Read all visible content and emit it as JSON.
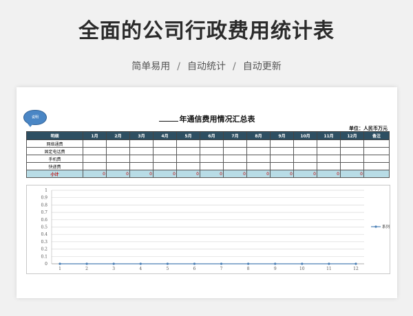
{
  "hero": {
    "title": "全面的公司行政费用统计表",
    "tags": [
      "简单易用",
      "自动统计",
      "自动更新"
    ],
    "separator": "/"
  },
  "sheet": {
    "bubble_text": "说明",
    "title": "年通信费用情况汇总表",
    "unit": "单位：人民币万元",
    "columns": [
      "明细",
      "1月",
      "2月",
      "3月",
      "4月",
      "5月",
      "6月",
      "7月",
      "8月",
      "9月",
      "10月",
      "11月",
      "12月",
      "备注"
    ],
    "rows": [
      "网络通费",
      "固定电话费",
      "手机费",
      "快递费"
    ],
    "subtotal_label": "小计",
    "subtotal_values": [
      "0",
      "0",
      "0",
      "0",
      "0",
      "0",
      "0",
      "0",
      "0",
      "0",
      "0",
      "0"
    ]
  },
  "chart_data": {
    "type": "line",
    "x": [
      1,
      2,
      3,
      4,
      5,
      6,
      7,
      8,
      9,
      10,
      11,
      12
    ],
    "series": [
      {
        "name": "系列1",
        "values": [
          0,
          0,
          0,
          0,
          0,
          0,
          0,
          0,
          0,
          0,
          0,
          0
        ]
      }
    ],
    "ylim": [
      0,
      1
    ],
    "yticks": [
      0,
      0.1,
      0.2,
      0.3,
      0.4,
      0.5,
      0.6,
      0.7,
      0.8,
      0.9,
      1
    ],
    "grid": true,
    "legend": "right",
    "color": "#4a7fb5"
  }
}
